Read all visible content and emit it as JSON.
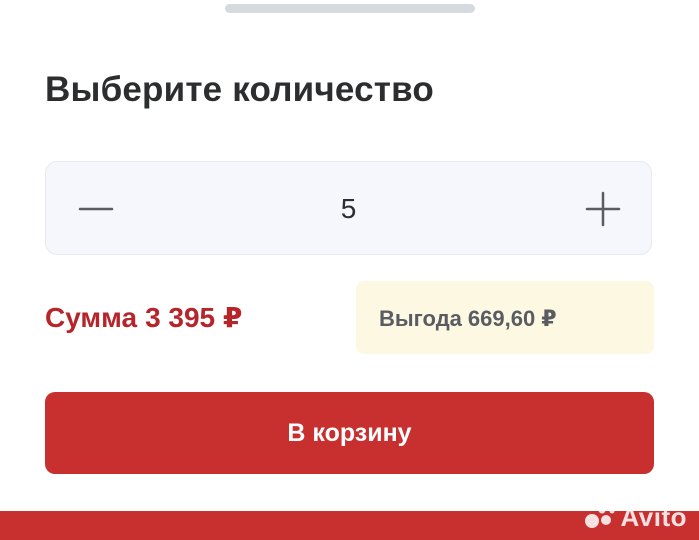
{
  "sheet": {
    "title": "Выберите количество"
  },
  "quantity": {
    "value": "5",
    "minus_icon": "minus-icon",
    "plus_icon": "plus-icon"
  },
  "summary": {
    "sum_label": "Сумма",
    "sum_value": "3 395 ₽",
    "benefit_label": "Выгода",
    "benefit_value": "669,60 ₽"
  },
  "actions": {
    "cart_label": "В корзину"
  },
  "watermark": {
    "text": "Avito"
  },
  "colors": {
    "accent": "#c8302f",
    "sum_text": "#b5252a",
    "benefit_bg": "#fdf8e1",
    "stepper_bg": "#f5f7fc"
  }
}
